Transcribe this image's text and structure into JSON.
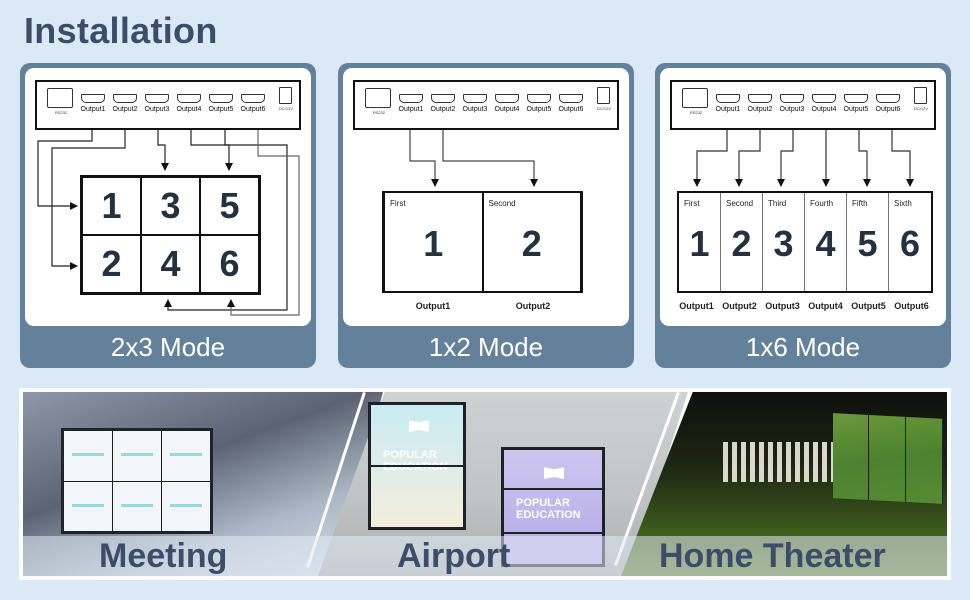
{
  "header": {
    "title": "Installation"
  },
  "device": {
    "rs232_label": "RS232",
    "dc_label": "DC/12V",
    "outputs": [
      "Output1",
      "Output2",
      "Output3",
      "Output4",
      "Output5",
      "Output6"
    ]
  },
  "modes": [
    {
      "label": "2x3 Mode",
      "grid_numbers": [
        "1",
        "3",
        "5",
        "2",
        "4",
        "6"
      ]
    },
    {
      "label": "1x2 Mode",
      "cells": [
        {
          "name": "First",
          "number": "1",
          "output": "Output1"
        },
        {
          "name": "Second",
          "number": "2",
          "output": "Output2"
        }
      ]
    },
    {
      "label": "1x6 Mode",
      "cells": [
        {
          "name": "First",
          "number": "1",
          "output": "Output1"
        },
        {
          "name": "Second",
          "number": "2",
          "output": "Output2"
        },
        {
          "name": "Third",
          "number": "3",
          "output": "Output3"
        },
        {
          "name": "Fourth",
          "number": "4",
          "output": "Output4"
        },
        {
          "name": "Fifth",
          "number": "5",
          "output": "Output5"
        },
        {
          "name": "Sixth",
          "number": "6",
          "output": "Output6"
        }
      ]
    }
  ],
  "scenes": [
    {
      "label": "Meeting"
    },
    {
      "label": "Airport",
      "poster_text": [
        "POPULAR",
        "EDUCATION"
      ]
    },
    {
      "label": "Home Theater"
    }
  ],
  "colors": {
    "background": "#dbe8f5",
    "panel": "#64819b",
    "title": "#3b4d68",
    "digit": "#24313f"
  }
}
